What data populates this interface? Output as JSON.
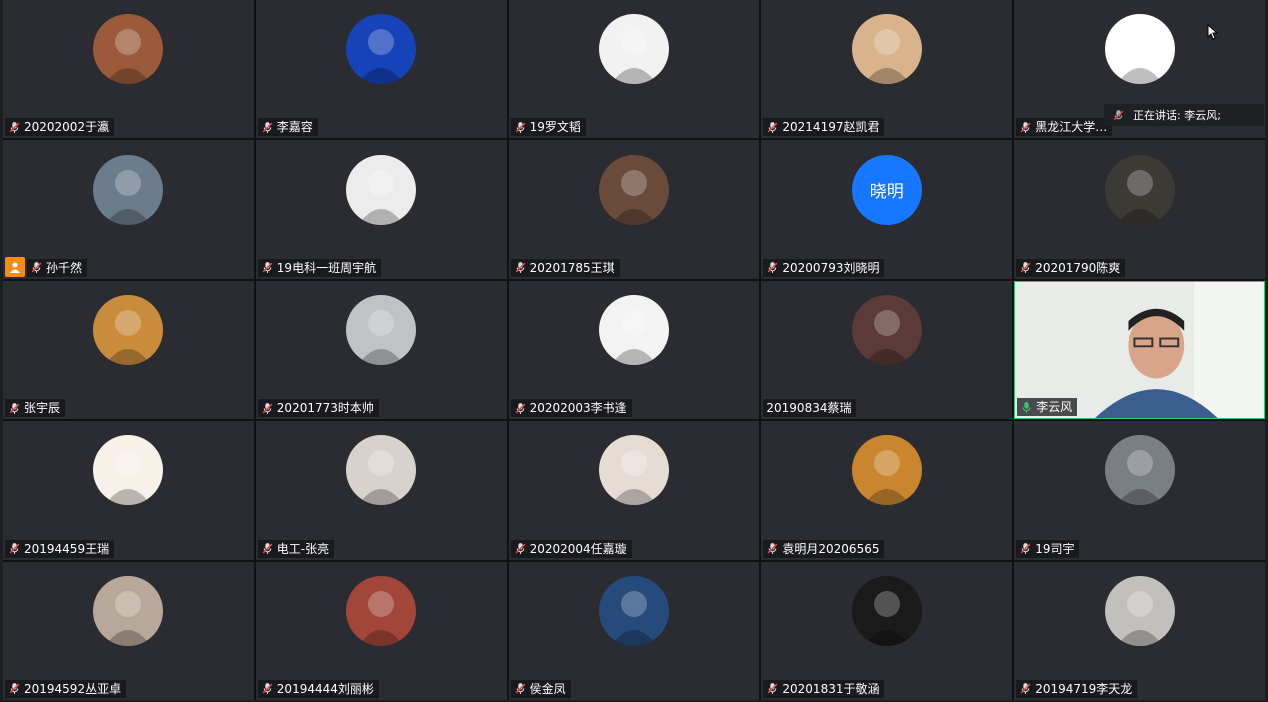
{
  "participants": [
    {
      "name": "20202002于瀛",
      "avatar": "bear-cartoon-avatar",
      "bg": "#9b5a3a"
    },
    {
      "name": "李嘉容",
      "avatar": "woman-blue-bg-avatar",
      "bg": "#1743b8"
    },
    {
      "name": "19罗文韬",
      "avatar": "man-suit-avatar",
      "bg": "#f2f2f2"
    },
    {
      "name": "20214197赵凯君",
      "avatar": "girl-dog-avatar",
      "bg": "#d9b38c"
    },
    {
      "name": "黑龙江大学…",
      "avatar": "pink-cat-plant-avatar",
      "bg": "#ffffff"
    },
    {
      "name": "孙千然",
      "avatar": "cat-avatar",
      "bg": "#6b7c8c"
    },
    {
      "name": "19电科一班周宇航",
      "avatar": "man-portrait-avatar",
      "bg": "#ececec"
    },
    {
      "name": "20201785王琪",
      "avatar": "woman-hat-avatar",
      "bg": "#6a4a3a"
    },
    {
      "name": "20200793刘晓明",
      "avatar": "text-avatar",
      "bg": "#1677ff",
      "text": "晓明"
    },
    {
      "name": "20201790陈爽",
      "avatar": "man-dark-avatar",
      "bg": "#3b3a34"
    },
    {
      "name": "张宇辰",
      "avatar": "puppy-avatar",
      "bg": "#c98b3c"
    },
    {
      "name": "20201773时本帅",
      "avatar": "paper-avatar",
      "bg": "#bfc3c6"
    },
    {
      "name": "20202003李书逢",
      "avatar": "young-man-avatar",
      "bg": "#f3f3f3"
    },
    {
      "name": "20190834蔡瑞",
      "avatar": "girl-dark-avatar",
      "bg": "#5b3a38"
    },
    {
      "name": "李云风",
      "avatar": "video-feed",
      "bg": "#e6e7e4"
    },
    {
      "name": "20194459王瑞",
      "avatar": "flower-illustration-avatar",
      "bg": "#f8f1ea"
    },
    {
      "name": "电工-张亮",
      "avatar": "white-dog-avatar",
      "bg": "#d8d2cc"
    },
    {
      "name": "20202004任嘉璇",
      "avatar": "girl-white-avatar",
      "bg": "#e6dcd6"
    },
    {
      "name": "袁明月20206565",
      "avatar": "warm-room-avatar",
      "bg": "#c9862f"
    },
    {
      "name": "19司宇",
      "avatar": "cat-sunglasses-avatar",
      "bg": "#7a7f84"
    },
    {
      "name": "20194592丛亚卓",
      "avatar": "street-avatar",
      "bg": "#b8a89a"
    },
    {
      "name": "20194444刘丽彬",
      "avatar": "woman-red-avatar",
      "bg": "#a2463a"
    },
    {
      "name": "侯金凤",
      "avatar": "sky-avatar",
      "bg": "#254a7c"
    },
    {
      "name": "20201831于敬涵",
      "avatar": "dark-face-avatar",
      "bg": "#1a1a1a"
    },
    {
      "name": "20194719李天龙",
      "avatar": "shiba-avatar",
      "bg": "#c2c0bc"
    }
  ],
  "speaking": {
    "label": "正在讲话: 李云风;"
  }
}
